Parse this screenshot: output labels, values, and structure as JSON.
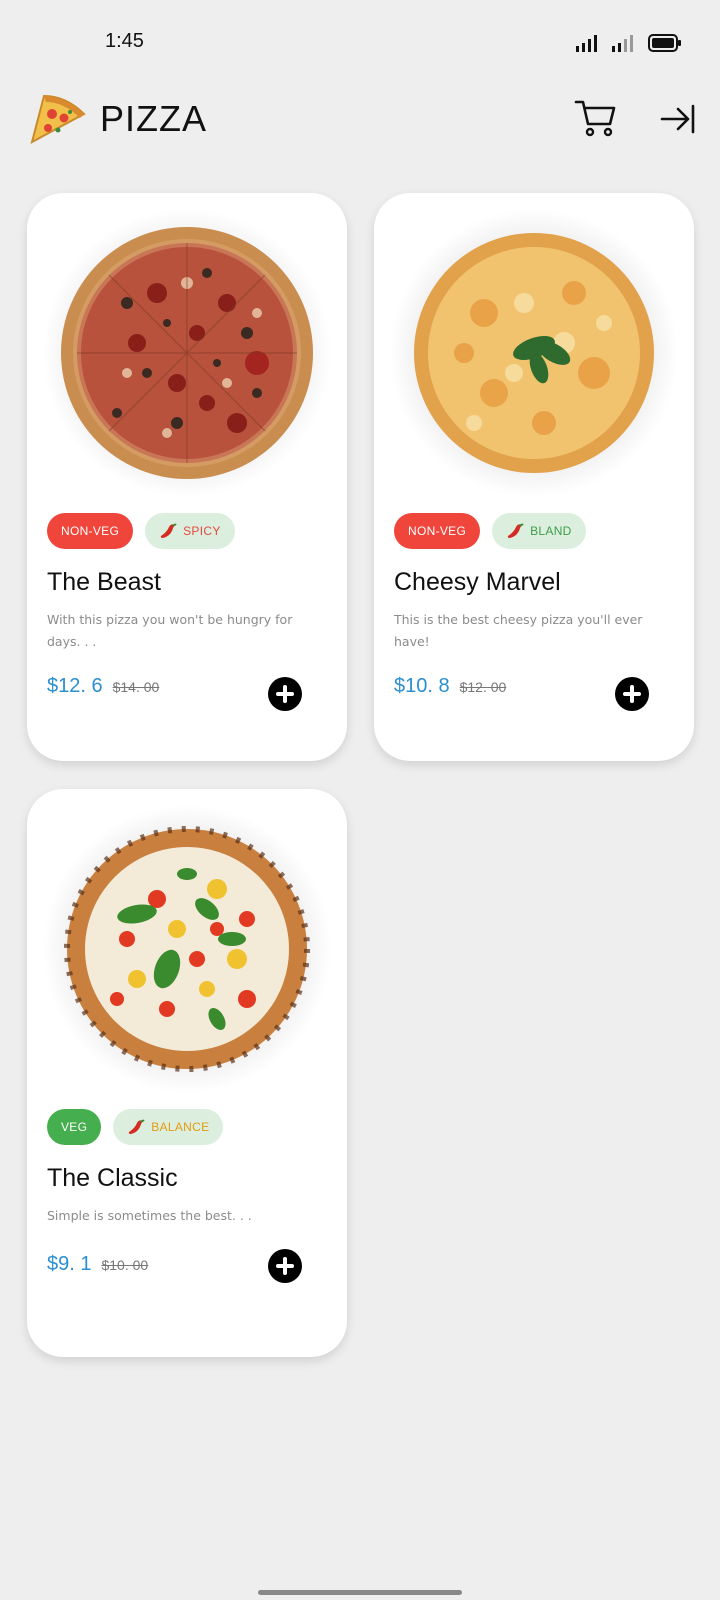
{
  "status": {
    "time": "1:45"
  },
  "header": {
    "title": "PIZZA",
    "cart_icon": "cart-icon",
    "logout_icon": "arrow-to-right-icon"
  },
  "colors": {
    "price": "#2a8fd0",
    "non_veg": "#f0453a",
    "veg": "#45ae4f",
    "spice_bg": "#dcefdf"
  },
  "products": [
    {
      "type_tag": "NON-VEG",
      "spice_tag": "SPICY",
      "title": "The Beast",
      "description": "With this pizza you won't be hungry for days. . .",
      "price": "$12. 6",
      "old_price": "$14. 00"
    },
    {
      "type_tag": "NON-VEG",
      "spice_tag": "BLAND",
      "title": "Cheesy Marvel",
      "description": "This is the best cheesy pizza you'll ever have!",
      "price": "$10. 8",
      "old_price": "$12. 00"
    },
    {
      "type_tag": "VEG",
      "spice_tag": "BALANCE",
      "title": "The Classic",
      "description": "Simple is sometimes the best. . .",
      "price": "$9. 1",
      "old_price": "$10. 00"
    }
  ]
}
